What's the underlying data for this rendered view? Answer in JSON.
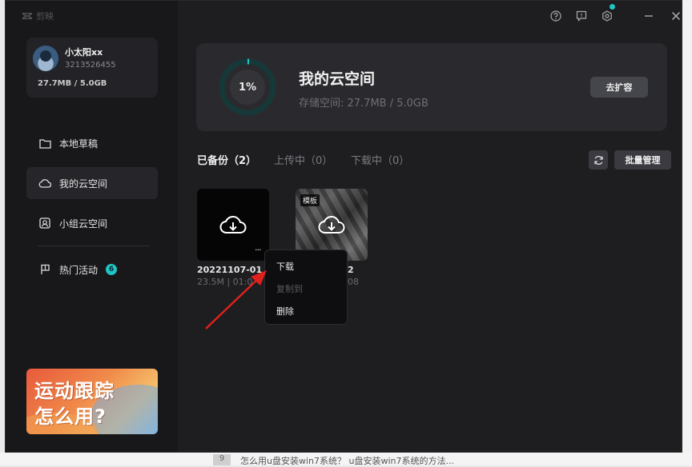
{
  "app": {
    "name": "剪映"
  },
  "user": {
    "name": "小太阳xx",
    "id": "3213526455",
    "storage": "27.7MB / 5.0GB"
  },
  "nav": [
    {
      "label": "本地草稿",
      "icon": "folder-icon"
    },
    {
      "label": "我的云空间",
      "icon": "cloud-icon"
    },
    {
      "label": "小组云空间",
      "icon": "group-icon"
    },
    {
      "label": "热门活动",
      "icon": "flag-icon",
      "badge": "6"
    }
  ],
  "promo": {
    "line1": "运动跟踪",
    "line2": "怎么用?"
  },
  "space": {
    "percent_label": "1%",
    "percent": 0.01,
    "title": "我的云空间",
    "subtitle": "存储空间: 27.7MB / 5.0GB",
    "expand_label": "去扩容"
  },
  "tabs": [
    {
      "label": "已备份（2）"
    },
    {
      "label": "上传中（0）"
    },
    {
      "label": "下载中（0）"
    }
  ],
  "toolbar": {
    "batch_label": "批量管理"
  },
  "files": [
    {
      "title": "20221107-01",
      "meta": "23.5M | 01:0"
    },
    {
      "title": "2",
      "meta": "08",
      "tag": "模板"
    }
  ],
  "context_menu": {
    "items": [
      {
        "label": "下载",
        "enabled": true
      },
      {
        "label": "复制到",
        "enabled": false
      },
      {
        "label": "删除",
        "enabled": true
      }
    ]
  },
  "background": {
    "page_number": "9",
    "snippet": "怎么用u盘安装win7系统？ u盘安装win7系统的方法..."
  },
  "colors": {
    "accent": "#20c4c4",
    "arrow": "#e0201c",
    "window_bg": "#1c1c1f"
  }
}
